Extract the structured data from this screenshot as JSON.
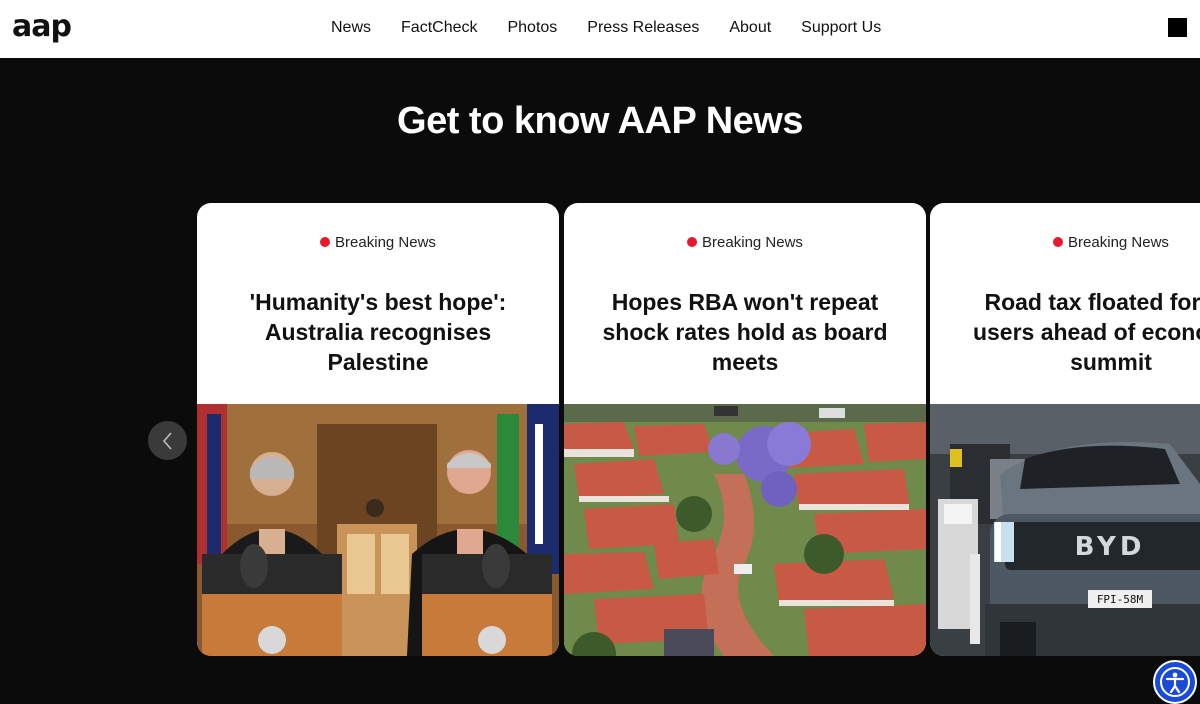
{
  "header": {
    "logo": "aap",
    "nav": [
      "News",
      "FactCheck",
      "Photos",
      "Press Releases",
      "About",
      "Support Us"
    ]
  },
  "hero": {
    "title": "Get to know AAP News"
  },
  "cards": [
    {
      "badge": "Breaking News",
      "headline": "'Humanity's best hope': Australia recognises Palestine"
    },
    {
      "badge": "Breaking News",
      "headline": "Hopes RBA won't repeat shock rates hold as board meets"
    },
    {
      "badge": "Breaking News",
      "headline": "Road tax floated for EV users ahead of economic summit"
    }
  ],
  "icons": {
    "prev": "chevron-left-icon",
    "menu": "menu-icon",
    "accessibility": "accessibility-icon"
  },
  "colors": {
    "background": "#0b0b0b",
    "breaking_dot": "#e8192c",
    "accessibility_button": "#1a4ad6"
  }
}
